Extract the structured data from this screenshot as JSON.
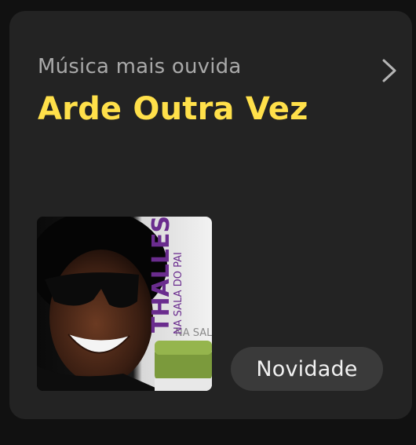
{
  "card": {
    "subtitle": "Música mais ouvida",
    "title": "Arde Outra Vez",
    "chevron_icon": "chevron-right-icon",
    "badge": "Novidade",
    "colors": {
      "background": "#232323",
      "title": "#ffe04a",
      "subtitle": "#a9a9a9",
      "badge_bg": "#3a3a3a"
    }
  },
  "cover": {
    "artist": "THALLES",
    "album": "NA SALA DO PAI",
    "background_text": "NA SALA D"
  }
}
